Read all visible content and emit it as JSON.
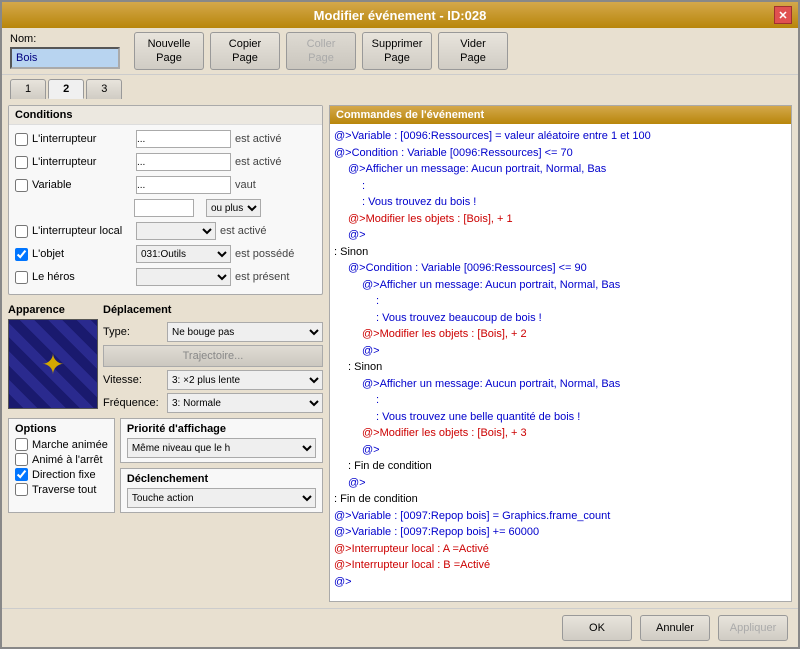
{
  "window": {
    "title": "Modifier événement - ID:028",
    "close_label": "✕"
  },
  "toolbar": {
    "name_label": "Nom:",
    "name_value": "Bois",
    "btn_nouvelle": "Nouvelle\nPage",
    "btn_copier": "Copier\nPage",
    "btn_coller": "Coller\nPage",
    "btn_supprimer": "Supprimer\nPage",
    "btn_vider": "Vider\nPage"
  },
  "tabs": [
    {
      "label": "1"
    },
    {
      "label": "2",
      "active": true
    },
    {
      "label": "3"
    }
  ],
  "conditions": {
    "title": "Conditions",
    "rows": [
      {
        "checkbox": false,
        "label": "L'interrupteur",
        "value": "...",
        "suffix": "est activé"
      },
      {
        "checkbox": false,
        "label": "L'interrupteur",
        "value": "...",
        "suffix": "est activé"
      },
      {
        "checkbox": false,
        "label": "Variable",
        "value": "...",
        "suffix": "vaut"
      },
      {
        "suffix": "ou plus"
      },
      {
        "checkbox": false,
        "label": "L'interrupteur local",
        "suffix": "est activé"
      },
      {
        "checkbox": true,
        "label": "L'objet",
        "value": "031:Outils",
        "suffix": "est possédé"
      },
      {
        "checkbox": false,
        "label": "Le héros",
        "suffix": "est présent"
      }
    ]
  },
  "appearance": {
    "title": "Apparence"
  },
  "movement": {
    "title": "Déplacement",
    "type_label": "Type:",
    "type_value": "Ne bouge pas",
    "traj_label": "Trajectoire...",
    "speed_label": "Vitesse:",
    "speed_value": "3: ×2 plus lente",
    "freq_label": "Fréquence:",
    "freq_value": "3: Normale"
  },
  "options": {
    "title": "Options",
    "items": [
      {
        "label": "Marche animée",
        "checked": false
      },
      {
        "label": "Animé à l'arrêt",
        "checked": false
      },
      {
        "label": "Direction fixe",
        "checked": true
      },
      {
        "label": "Traverse tout",
        "checked": false
      }
    ]
  },
  "priority": {
    "title": "Priorité d'affichage",
    "value": "Même niveau que le h"
  },
  "declenchement": {
    "title": "Déclenchement",
    "value": "Touche action"
  },
  "right_panel": {
    "title": "Commandes de l'événement",
    "commands": [
      {
        "indent": 0,
        "color": "blue",
        "text": "@>Variable : [0096:Ressources] = valeur aléatoire entre 1 et 100"
      },
      {
        "indent": 0,
        "color": "blue",
        "text": "@>Condition : Variable [0096:Ressources] <= 70"
      },
      {
        "indent": 1,
        "color": "blue",
        "text": "@>Afficher un message: Aucun portrait, Normal, Bas"
      },
      {
        "indent": 2,
        "color": "blue",
        "text": ":"
      },
      {
        "indent": 2,
        "color": "blue",
        "text": ": Vous trouvez du bois !"
      },
      {
        "indent": 1,
        "color": "red",
        "text": "@>Modifier les objets : [Bois], + 1"
      },
      {
        "indent": 1,
        "color": "blue",
        "text": "@>"
      },
      {
        "indent": 0,
        "color": "black",
        "text": ": Sinon"
      },
      {
        "indent": 1,
        "color": "blue",
        "text": "@>Condition : Variable [0096:Ressources] <= 90"
      },
      {
        "indent": 2,
        "color": "blue",
        "text": "@>Afficher un message: Aucun portrait, Normal, Bas"
      },
      {
        "indent": 3,
        "color": "blue",
        "text": ":"
      },
      {
        "indent": 3,
        "color": "blue",
        "text": ": Vous trouvez beaucoup de bois !"
      },
      {
        "indent": 2,
        "color": "red",
        "text": "@>Modifier les objets : [Bois], + 2"
      },
      {
        "indent": 2,
        "color": "blue",
        "text": "@>"
      },
      {
        "indent": 1,
        "color": "black",
        "text": ": Sinon"
      },
      {
        "indent": 2,
        "color": "blue",
        "text": "@>Afficher un message: Aucun portrait, Normal, Bas"
      },
      {
        "indent": 3,
        "color": "blue",
        "text": ":"
      },
      {
        "indent": 3,
        "color": "blue",
        "text": ": Vous trouvez une belle quantité de bois !"
      },
      {
        "indent": 2,
        "color": "red",
        "text": "@>Modifier les objets : [Bois], + 3"
      },
      {
        "indent": 2,
        "color": "blue",
        "text": "@>"
      },
      {
        "indent": 1,
        "color": "black",
        "text": ": Fin de condition"
      },
      {
        "indent": 1,
        "color": "blue",
        "text": "@>"
      },
      {
        "indent": 0,
        "color": "black",
        "text": ": Fin de condition"
      },
      {
        "indent": 0,
        "color": "blue",
        "text": "@>Variable : [0097:Repop bois] = Graphics.frame_count"
      },
      {
        "indent": 0,
        "color": "blue",
        "text": "@>Variable : [0097:Repop bois] += 60000"
      },
      {
        "indent": 0,
        "color": "red",
        "text": "@>Interrupteur local : A =Activé"
      },
      {
        "indent": 0,
        "color": "red",
        "text": "@>Interrupteur local : B =Activé"
      },
      {
        "indent": 0,
        "color": "blue",
        "text": "@>"
      }
    ]
  },
  "footer": {
    "ok": "OK",
    "annuler": "Annuler",
    "appliquer": "Appliquer"
  }
}
